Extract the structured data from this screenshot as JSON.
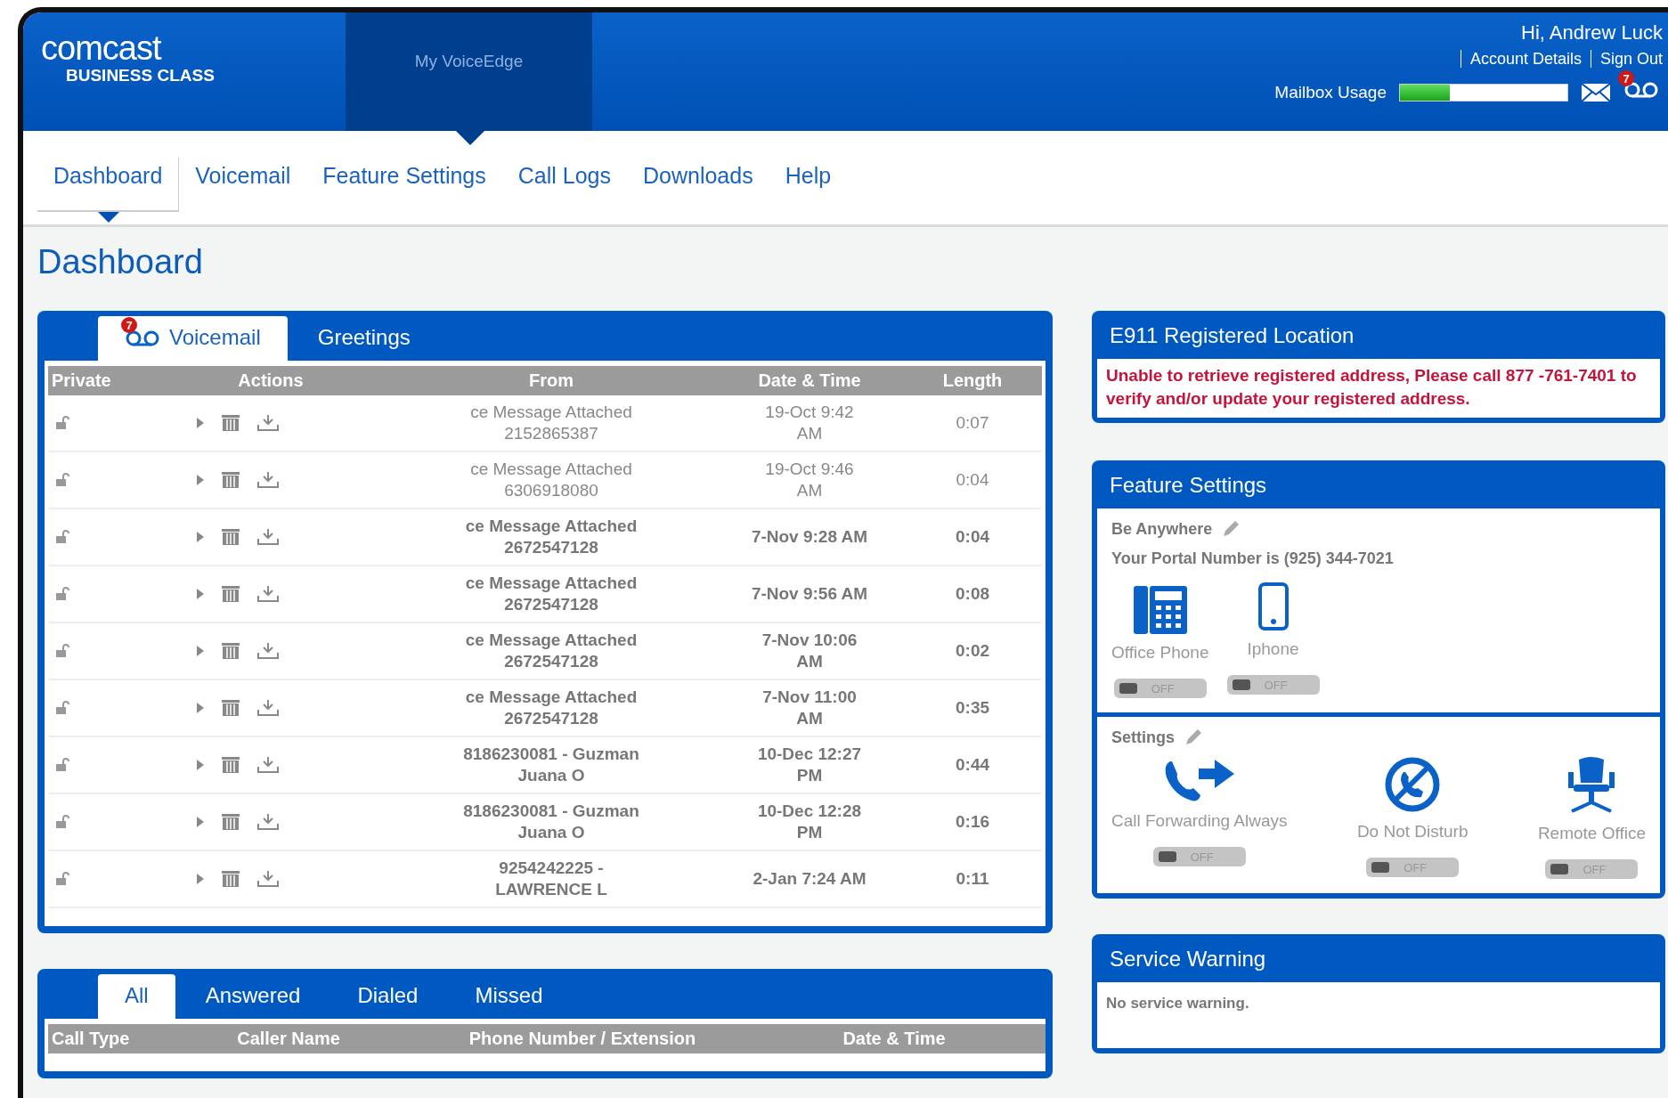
{
  "header": {
    "logo": {
      "wordmark": "comcast",
      "tagline": "BUSINESS CLASS"
    },
    "product_tab": "My VoiceEdge",
    "greeting": "Hi, Andrew Luck",
    "links": [
      "Account Details",
      "Sign Out"
    ],
    "mailbox_usage": {
      "label": "Mailbox Usage",
      "level": 0.3
    },
    "voicemail_badge": "7"
  },
  "nav": [
    {
      "label": "Dashboard",
      "selected": true
    },
    {
      "label": "Voicemail",
      "selected": false
    },
    {
      "label": "Feature Settings",
      "selected": false
    },
    {
      "label": "Call Logs",
      "selected": false
    },
    {
      "label": "Downloads",
      "selected": false
    },
    {
      "label": "Help",
      "selected": false
    }
  ],
  "page_title": "Dashboard",
  "voicemail_panel": {
    "tabs": [
      {
        "label": "Voicemail",
        "selected": true,
        "badge": "7"
      },
      {
        "label": "Greetings",
        "selected": false
      }
    ],
    "columns": [
      "Private",
      "Actions",
      "From",
      "Date & Time",
      "Length"
    ],
    "rows": [
      {
        "from": [
          "ce Message Attached",
          "2152865387"
        ],
        "date": [
          "19-Oct 9:42",
          "AM"
        ],
        "length": "0:07",
        "unread": false
      },
      {
        "from": [
          "ce Message Attached",
          "6306918080"
        ],
        "date": [
          "19-Oct 9:46",
          "AM"
        ],
        "length": "0:04",
        "unread": false
      },
      {
        "from": [
          "ce Message Attached",
          "2672547128"
        ],
        "date": [
          "7-Nov 9:28 AM"
        ],
        "length": "0:04",
        "unread": true
      },
      {
        "from": [
          "ce Message Attached",
          "2672547128"
        ],
        "date": [
          "7-Nov 9:56 AM"
        ],
        "length": "0:08",
        "unread": true
      },
      {
        "from": [
          "ce Message Attached",
          "2672547128"
        ],
        "date": [
          "7-Nov 10:06",
          "AM"
        ],
        "length": "0:02",
        "unread": true
      },
      {
        "from": [
          "ce Message Attached",
          "2672547128"
        ],
        "date": [
          "7-Nov 11:00",
          "AM"
        ],
        "length": "0:35",
        "unread": true
      },
      {
        "from": [
          "8186230081 - Guzman",
          "Juana O"
        ],
        "date": [
          "10-Dec 12:27",
          "PM"
        ],
        "length": "0:44",
        "unread": true
      },
      {
        "from": [
          "8186230081 - Guzman",
          "Juana O"
        ],
        "date": [
          "10-Dec 12:28",
          "PM"
        ],
        "length": "0:16",
        "unread": true
      },
      {
        "from": [
          "9254242225 -",
          "LAWRENCE L"
        ],
        "date": [
          "2-Jan 7:24 AM"
        ],
        "length": "0:11",
        "unread": true
      }
    ]
  },
  "calls_panel": {
    "tabs": [
      {
        "label": "All",
        "selected": true
      },
      {
        "label": "Answered",
        "selected": false
      },
      {
        "label": "Dialed",
        "selected": false
      },
      {
        "label": "Missed",
        "selected": false
      }
    ],
    "columns": [
      "Call Type",
      "Caller Name",
      "Phone Number / Extension",
      "Date & Time"
    ]
  },
  "e911": {
    "title": "E911 Registered Location",
    "message": "Unable to retrieve registered address, Please call 877 -761-7401 to verify and/or update your registered address."
  },
  "feature_settings": {
    "title": "Feature Settings",
    "sections": [
      {
        "title": "Be Anywhere",
        "note": "Your Portal Number is (925) 344-7021",
        "items": [
          {
            "kind": "desk-phone",
            "label": "Office Phone",
            "on": false,
            "toggle_label": "OFF"
          },
          {
            "kind": "mobile",
            "label": "Iphone",
            "on": false,
            "toggle_label": "OFF"
          }
        ]
      },
      {
        "title": "Settings",
        "items": [
          {
            "kind": "forward",
            "label": "Call Forwarding Always",
            "on": false,
            "toggle_label": "OFF"
          },
          {
            "kind": "dnd",
            "label": "Do Not Disturb",
            "on": false,
            "toggle_label": "OFF"
          },
          {
            "kind": "chair",
            "label": "Remote Office",
            "on": false,
            "toggle_label": "OFF"
          }
        ]
      }
    ]
  },
  "service_warning": {
    "title": "Service Warning",
    "message": "No service warning."
  }
}
